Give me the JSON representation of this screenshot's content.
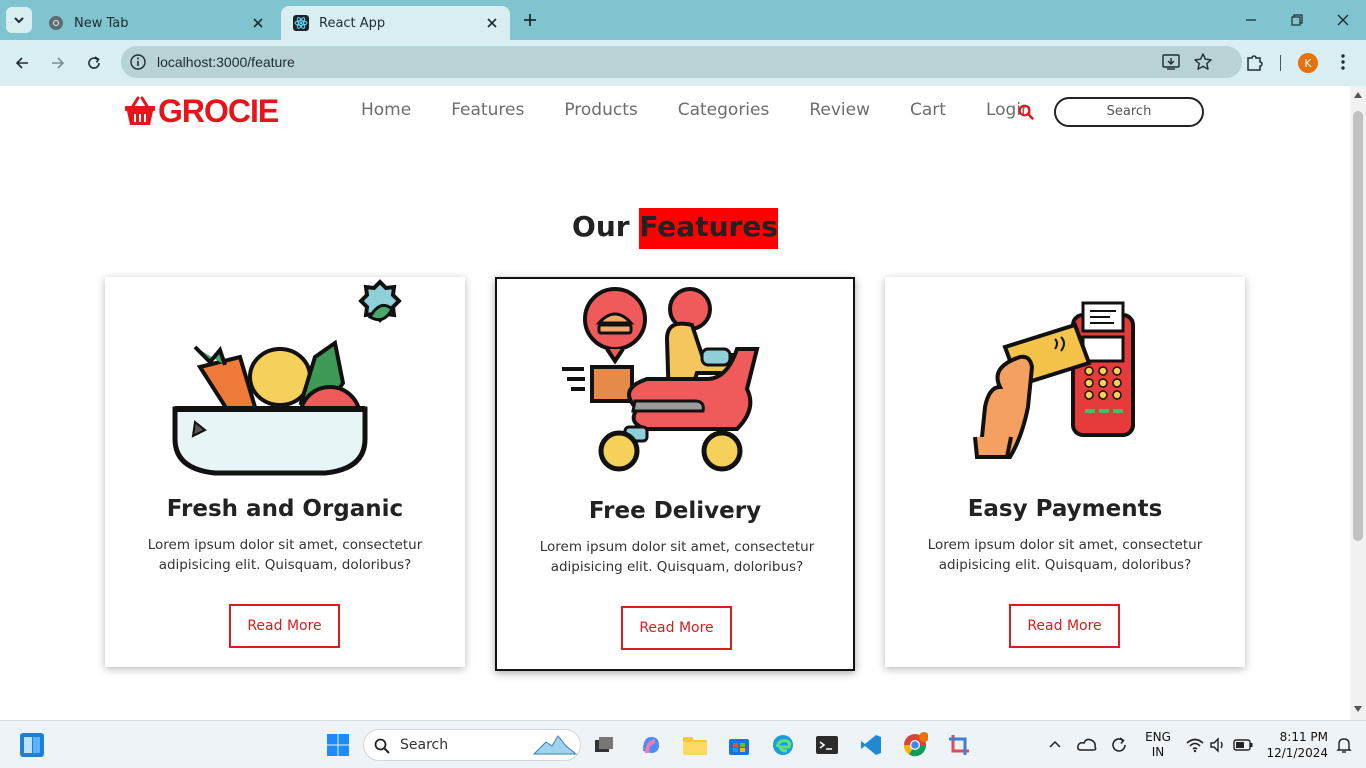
{
  "browser": {
    "tabs": [
      {
        "label": "New Tab",
        "icon": "chrome-icon"
      },
      {
        "label": "React App",
        "icon": "react-icon"
      }
    ],
    "url": "localhost:3000/feature",
    "profile_initial": "K"
  },
  "site": {
    "logo_text": "GROCIE",
    "nav": [
      "Home",
      "Features",
      "Products",
      "Categories",
      "Review",
      "Cart",
      "Login"
    ],
    "search_placeholder": "Search",
    "heading_plain": "Our ",
    "heading_highlight": "Features",
    "cards": [
      {
        "title": "Fresh and Organic",
        "desc": "Lorem ipsum dolor sit amet, consectetur adipisicing elit. Quisquam, doloribus?",
        "button": "Read More",
        "image": "vegetables-basket-illustration"
      },
      {
        "title": "Free Delivery",
        "desc": "Lorem ipsum dolor sit amet, consectetur adipisicing elit. Quisquam, doloribus?",
        "button": "Read More",
        "image": "delivery-scooter-illustration"
      },
      {
        "title": "Easy Payments",
        "desc": "Lorem ipsum dolor sit amet, consectetur adipisicing elit. Quisquam, doloribus?",
        "button": "Read More",
        "image": "card-payment-illustration"
      }
    ]
  },
  "taskbar": {
    "search_label": "Search",
    "lang_line1": "ENG",
    "lang_line2": "IN",
    "time": "8:11 PM",
    "date": "12/1/2024"
  },
  "colors": {
    "brand_red": "#e8141b",
    "browser_accent": "#7fc4cf"
  }
}
